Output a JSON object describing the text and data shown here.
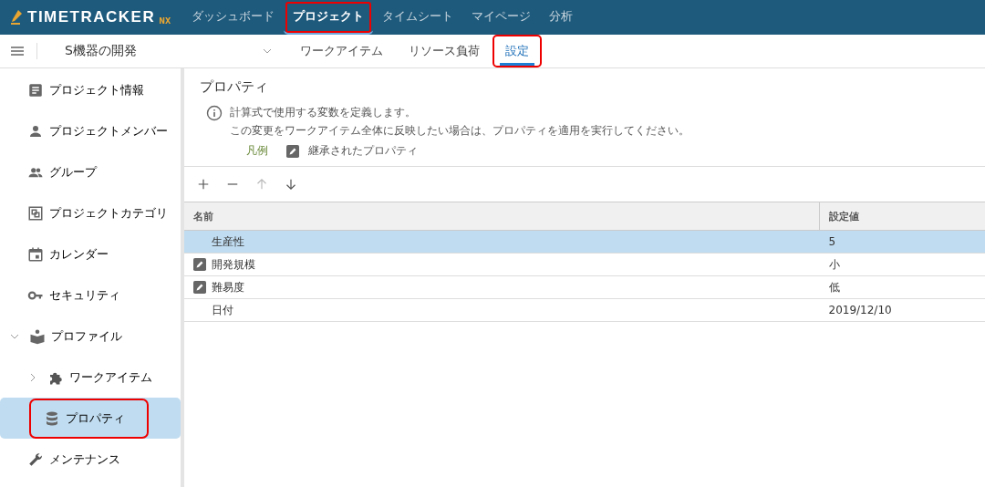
{
  "logo": {
    "name": "TIMETRACKER",
    "suffix": "NX"
  },
  "nav": [
    {
      "label": "ダッシュボード",
      "selected": false,
      "highlighted": false
    },
    {
      "label": "プロジェクト",
      "selected": true,
      "highlighted": true
    },
    {
      "label": "タイムシート",
      "selected": false,
      "highlighted": false
    },
    {
      "label": "マイページ",
      "selected": false,
      "highlighted": false
    },
    {
      "label": "分析",
      "selected": false,
      "highlighted": false
    }
  ],
  "project": {
    "name": "S機器の開発"
  },
  "tabs": [
    {
      "label": "ワークアイテム",
      "selected": false,
      "highlighted": false
    },
    {
      "label": "リソース負荷",
      "selected": false,
      "highlighted": false
    },
    {
      "label": "設定",
      "selected": true,
      "highlighted": true
    }
  ],
  "sidebar": {
    "items": [
      {
        "label": "プロジェクト情報",
        "selected": false,
        "highlighted": false
      },
      {
        "label": "プロジェクトメンバー",
        "selected": false,
        "highlighted": false
      },
      {
        "label": "グループ",
        "selected": false,
        "highlighted": false
      },
      {
        "label": "プロジェクトカテゴリ",
        "selected": false,
        "highlighted": false
      },
      {
        "label": "カレンダー",
        "selected": false,
        "highlighted": false
      },
      {
        "label": "セキュリティ",
        "selected": false,
        "highlighted": false
      },
      {
        "label": "プロファイル",
        "selected": false,
        "highlighted": false,
        "expanded": true,
        "children": [
          {
            "label": "ワークアイテム",
            "selected": false,
            "highlighted": false,
            "expanded": false
          },
          {
            "label": "プロパティ",
            "selected": true,
            "highlighted": true
          }
        ]
      },
      {
        "label": "メンテナンス",
        "selected": false,
        "highlighted": false
      }
    ]
  },
  "panel": {
    "title": "プロパティ",
    "info": [
      "計算式で使用する変数を定義します。",
      "この変更をワークアイテム全体に反映したい場合は、プロパティを適用を実行してください。"
    ],
    "legend": {
      "label": "凡例",
      "text": "継承されたプロパティ"
    }
  },
  "toolbar": [
    {
      "kind": "add",
      "disabled": false
    },
    {
      "kind": "remove",
      "disabled": false
    },
    {
      "kind": "up",
      "disabled": true
    },
    {
      "kind": "down",
      "disabled": false
    }
  ],
  "table": {
    "columns": [
      "名前",
      "設定値"
    ],
    "rows": [
      {
        "name": "生産性",
        "value": "5",
        "inherited": false,
        "selected": true
      },
      {
        "name": "開発規模",
        "value": "小",
        "inherited": true,
        "selected": false
      },
      {
        "name": "難易度",
        "value": "低",
        "inherited": true,
        "selected": false
      },
      {
        "name": "日付",
        "value": "2019/12/10",
        "inherited": false,
        "selected": false
      }
    ]
  }
}
